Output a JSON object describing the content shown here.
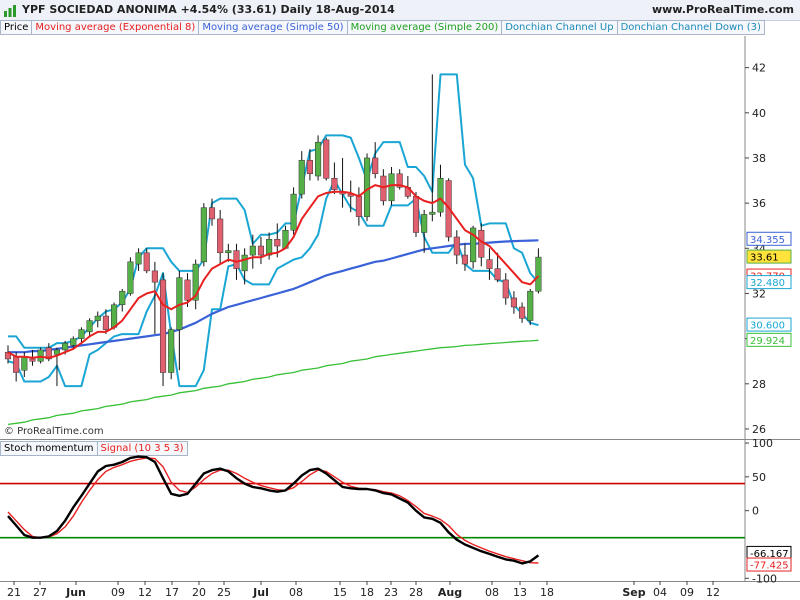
{
  "header": {
    "title": "YPF SOCIEDAD ANONIMA   +4.54% (33.61)   Daily   18-Aug-2014",
    "source": "www.ProRealTime.com"
  },
  "legend": [
    "Price",
    "Moving average (Exponential 8)",
    "Moving average (Simple 50)",
    "Moving average (Simple 200)",
    "Donchian Channel Up",
    "Donchian Channel Down (3)"
  ],
  "osc_legend": [
    "Stoch momentum",
    "Signal (10 3 5 3)"
  ],
  "copyright": "© ProRealTime.com",
  "colors": {
    "up": "#55b048",
    "down": "#e06070",
    "ema8": "#e82020",
    "sma50": "#3a62d8",
    "sma200": "#38c038",
    "donchian": "#1aa6d4",
    "stoch": "#000000",
    "signal": "#e82020",
    "level_upper": "#cc0000",
    "level_lower": "#008800"
  },
  "chart_data": [
    {
      "type": "candlestick",
      "title": "YPF SOCIEDAD ANONIMA",
      "ylim": [
        25.6,
        43.4
      ],
      "y_ticks": [
        26,
        28,
        30,
        32,
        34,
        36,
        38,
        40,
        42
      ],
      "x_ticks": [
        "21",
        "27",
        "Jun",
        "09",
        "12",
        "17",
        "20",
        "25",
        "Jul",
        "08",
        "15",
        "18",
        "23",
        "28",
        "Aug",
        "08",
        "13",
        "18",
        "Sep",
        "04",
        "09",
        "12"
      ],
      "value_labels": [
        {
          "text": "34.355",
          "value": 34.355,
          "series": "sma50"
        },
        {
          "text": "33.61",
          "value": 33.61,
          "series": "price"
        },
        {
          "text": "32.770",
          "value": 32.77,
          "series": "ema8"
        },
        {
          "text": "32.480",
          "value": 32.48,
          "series": "donchian"
        },
        {
          "text": "30.600",
          "value": 30.6,
          "series": "donchian"
        },
        {
          "text": "29.924",
          "value": 29.924,
          "series": "sma200"
        }
      ],
      "candles": [
        {
          "o": 29.4,
          "h": 29.7,
          "l": 28.9,
          "c": 29.1
        },
        {
          "o": 29.2,
          "h": 29.4,
          "l": 28.1,
          "c": 28.5
        },
        {
          "o": 28.6,
          "h": 29.4,
          "l": 28.3,
          "c": 29.2
        },
        {
          "o": 29.1,
          "h": 29.5,
          "l": 28.8,
          "c": 29.0
        },
        {
          "o": 29.0,
          "h": 29.6,
          "l": 28.9,
          "c": 29.5
        },
        {
          "o": 29.6,
          "h": 29.8,
          "l": 29.0,
          "c": 29.1
        },
        {
          "o": 29.3,
          "h": 29.6,
          "l": 27.9,
          "c": 29.5
        },
        {
          "o": 29.5,
          "h": 29.9,
          "l": 29.3,
          "c": 29.8
        },
        {
          "o": 29.7,
          "h": 30.1,
          "l": 29.5,
          "c": 30.0
        },
        {
          "o": 30.0,
          "h": 30.5,
          "l": 29.8,
          "c": 30.4
        },
        {
          "o": 30.3,
          "h": 30.9,
          "l": 30.1,
          "c": 30.8
        },
        {
          "o": 30.8,
          "h": 31.2,
          "l": 30.5,
          "c": 31.0
        },
        {
          "o": 31.0,
          "h": 31.3,
          "l": 30.2,
          "c": 30.4
        },
        {
          "o": 30.5,
          "h": 31.6,
          "l": 30.4,
          "c": 31.5
        },
        {
          "o": 31.5,
          "h": 32.2,
          "l": 31.2,
          "c": 32.1
        },
        {
          "o": 32.0,
          "h": 33.6,
          "l": 31.9,
          "c": 33.4
        },
        {
          "o": 33.3,
          "h": 34.0,
          "l": 33.0,
          "c": 33.8
        },
        {
          "o": 33.8,
          "h": 34.0,
          "l": 32.9,
          "c": 33.0
        },
        {
          "o": 33.0,
          "h": 33.4,
          "l": 30.2,
          "c": 32.5
        },
        {
          "o": 32.6,
          "h": 32.9,
          "l": 27.9,
          "c": 28.5
        },
        {
          "o": 28.5,
          "h": 30.5,
          "l": 28.2,
          "c": 30.4
        },
        {
          "o": 30.4,
          "h": 33.0,
          "l": 28.6,
          "c": 32.7
        },
        {
          "o": 32.6,
          "h": 32.9,
          "l": 31.4,
          "c": 31.7
        },
        {
          "o": 31.7,
          "h": 33.5,
          "l": 31.3,
          "c": 33.3
        },
        {
          "o": 33.4,
          "h": 36.0,
          "l": 33.2,
          "c": 35.8
        },
        {
          "o": 35.8,
          "h": 36.2,
          "l": 35.0,
          "c": 35.3
        },
        {
          "o": 35.3,
          "h": 35.7,
          "l": 33.3,
          "c": 33.8
        },
        {
          "o": 33.8,
          "h": 34.2,
          "l": 33.4,
          "c": 33.9
        },
        {
          "o": 33.9,
          "h": 34.2,
          "l": 32.6,
          "c": 33.1
        },
        {
          "o": 33.0,
          "h": 34.0,
          "l": 32.4,
          "c": 33.7
        },
        {
          "o": 33.7,
          "h": 34.6,
          "l": 33.1,
          "c": 34.1
        },
        {
          "o": 34.1,
          "h": 34.5,
          "l": 33.3,
          "c": 33.7
        },
        {
          "o": 33.7,
          "h": 34.7,
          "l": 33.5,
          "c": 34.4
        },
        {
          "o": 34.4,
          "h": 35.1,
          "l": 33.6,
          "c": 34.1
        },
        {
          "o": 34.0,
          "h": 35.0,
          "l": 34.0,
          "c": 34.8
        },
        {
          "o": 34.8,
          "h": 36.7,
          "l": 34.6,
          "c": 36.4
        },
        {
          "o": 36.4,
          "h": 38.3,
          "l": 36.2,
          "c": 37.9
        },
        {
          "o": 37.9,
          "h": 38.4,
          "l": 37.0,
          "c": 37.3
        },
        {
          "o": 37.2,
          "h": 39.0,
          "l": 37.0,
          "c": 38.7
        },
        {
          "o": 38.8,
          "h": 38.9,
          "l": 37.0,
          "c": 37.1
        },
        {
          "o": 37.1,
          "h": 37.8,
          "l": 36.4,
          "c": 36.6
        },
        {
          "o": 36.5,
          "h": 38.0,
          "l": 35.8,
          "c": 36.4
        },
        {
          "o": 36.4,
          "h": 37.0,
          "l": 35.6,
          "c": 36.3
        },
        {
          "o": 36.3,
          "h": 36.7,
          "l": 35.0,
          "c": 35.4
        },
        {
          "o": 35.4,
          "h": 38.2,
          "l": 35.2,
          "c": 38.0
        },
        {
          "o": 38.0,
          "h": 38.7,
          "l": 37.1,
          "c": 37.3
        },
        {
          "o": 37.2,
          "h": 37.5,
          "l": 35.9,
          "c": 36.1
        },
        {
          "o": 36.1,
          "h": 37.6,
          "l": 35.9,
          "c": 37.3
        },
        {
          "o": 37.3,
          "h": 37.5,
          "l": 36.6,
          "c": 36.7
        },
        {
          "o": 36.7,
          "h": 37.2,
          "l": 36.2,
          "c": 36.3
        },
        {
          "o": 36.3,
          "h": 36.5,
          "l": 34.5,
          "c": 34.7
        },
        {
          "o": 34.7,
          "h": 35.7,
          "l": 33.8,
          "c": 35.5
        },
        {
          "o": 35.5,
          "h": 41.7,
          "l": 35.2,
          "c": 35.6
        },
        {
          "o": 35.6,
          "h": 37.7,
          "l": 35.4,
          "c": 37.1
        },
        {
          "o": 37.0,
          "h": 37.1,
          "l": 34.3,
          "c": 34.5
        },
        {
          "o": 34.5,
          "h": 34.8,
          "l": 33.3,
          "c": 33.7
        },
        {
          "o": 33.7,
          "h": 34.2,
          "l": 33.0,
          "c": 33.3
        },
        {
          "o": 33.4,
          "h": 35.0,
          "l": 33.1,
          "c": 34.9
        },
        {
          "o": 34.8,
          "h": 35.1,
          "l": 33.2,
          "c": 33.6
        },
        {
          "o": 33.5,
          "h": 34.0,
          "l": 32.6,
          "c": 33.1
        },
        {
          "o": 33.1,
          "h": 33.8,
          "l": 32.5,
          "c": 32.6
        },
        {
          "o": 32.6,
          "h": 32.9,
          "l": 31.5,
          "c": 31.8
        },
        {
          "o": 31.8,
          "h": 32.1,
          "l": 31.1,
          "c": 31.4
        },
        {
          "o": 31.4,
          "h": 31.6,
          "l": 30.7,
          "c": 30.9
        },
        {
          "o": 30.8,
          "h": 32.2,
          "l": 30.6,
          "c": 32.1
        },
        {
          "o": 32.1,
          "h": 34.0,
          "l": 32.0,
          "c": 33.61
        }
      ],
      "ema8": [
        29.4,
        29.2,
        29.2,
        29.15,
        29.2,
        29.15,
        29.25,
        29.4,
        29.55,
        29.8,
        30.1,
        30.3,
        30.3,
        30.5,
        30.8,
        31.3,
        31.8,
        32.0,
        32.1,
        31.5,
        31.3,
        31.5,
        31.6,
        31.9,
        32.6,
        33.1,
        33.3,
        33.5,
        33.4,
        33.5,
        33.6,
        33.6,
        33.75,
        33.8,
        34.0,
        34.5,
        35.3,
        35.8,
        36.3,
        36.45,
        36.5,
        36.5,
        36.45,
        36.3,
        36.6,
        36.8,
        36.7,
        36.8,
        36.8,
        36.7,
        36.3,
        36.1,
        36.0,
        36.2,
        35.8,
        35.3,
        34.8,
        34.6,
        34.3,
        34.1,
        33.7,
        33.3,
        32.9,
        32.5,
        32.4,
        32.77
      ],
      "sma50": [
        29.4,
        29.4,
        29.4,
        29.45,
        29.45,
        29.5,
        29.55,
        29.6,
        29.65,
        29.7,
        29.75,
        29.8,
        29.85,
        29.9,
        29.95,
        30.0,
        30.05,
        30.1,
        30.15,
        30.2,
        30.3,
        30.4,
        30.55,
        30.7,
        30.9,
        31.1,
        31.25,
        31.4,
        31.5,
        31.6,
        31.7,
        31.8,
        31.9,
        32.0,
        32.1,
        32.2,
        32.35,
        32.5,
        32.65,
        32.8,
        32.9,
        33.0,
        33.1,
        33.2,
        33.3,
        33.4,
        33.45,
        33.55,
        33.65,
        33.75,
        33.85,
        33.95,
        34.0,
        34.05,
        34.1,
        34.15,
        34.2,
        34.2,
        34.22,
        34.25,
        34.28,
        34.3,
        34.32,
        34.33,
        34.34,
        34.355
      ],
      "sma200": [
        26.2,
        26.25,
        26.3,
        26.4,
        26.45,
        26.5,
        26.6,
        26.65,
        26.7,
        26.8,
        26.85,
        26.9,
        27.0,
        27.05,
        27.1,
        27.2,
        27.25,
        27.3,
        27.4,
        27.45,
        27.5,
        27.6,
        27.65,
        27.7,
        27.8,
        27.85,
        27.9,
        28.0,
        28.05,
        28.1,
        28.2,
        28.25,
        28.3,
        28.4,
        28.45,
        28.5,
        28.6,
        28.65,
        28.7,
        28.8,
        28.85,
        28.9,
        29.0,
        29.05,
        29.1,
        29.2,
        29.25,
        29.3,
        29.35,
        29.4,
        29.45,
        29.5,
        29.55,
        29.6,
        29.62,
        29.65,
        29.7,
        29.72,
        29.75,
        29.78,
        29.8,
        29.83,
        29.86,
        29.88,
        29.9,
        29.924
      ],
      "donchian_up": [
        30.1,
        30.1,
        29.6,
        29.6,
        29.6,
        29.6,
        29.8,
        29.8,
        29.9,
        30.1,
        30.5,
        30.9,
        31.2,
        31.3,
        31.6,
        32.2,
        33.6,
        34.0,
        34.0,
        34.0,
        33.4,
        33.0,
        33.0,
        33.0,
        33.5,
        36.0,
        36.2,
        36.2,
        36.2,
        35.7,
        34.2,
        34.6,
        34.6,
        34.7,
        35.1,
        35.1,
        36.7,
        38.3,
        38.4,
        39.0,
        39.0,
        39.0,
        38.9,
        38.0,
        37.0,
        38.2,
        38.7,
        38.7,
        38.7,
        37.6,
        37.6,
        37.2,
        36.5,
        41.7,
        41.7,
        41.7,
        37.7,
        37.1,
        35.0,
        35.1,
        35.1,
        35.1,
        34.0,
        33.8,
        32.9,
        32.48
      ],
      "donchian_down": [
        29.0,
        28.9,
        28.1,
        28.1,
        28.1,
        28.3,
        28.8,
        27.9,
        27.9,
        27.9,
        29.3,
        29.5,
        29.8,
        30.1,
        30.2,
        30.2,
        30.2,
        31.2,
        31.9,
        32.9,
        30.2,
        27.9,
        27.9,
        27.9,
        28.6,
        31.3,
        31.3,
        33.2,
        33.3,
        32.6,
        32.4,
        32.4,
        32.4,
        33.1,
        33.3,
        33.5,
        33.6,
        34.0,
        34.6,
        36.2,
        37.0,
        36.4,
        35.8,
        35.6,
        35.0,
        35.0,
        35.0,
        35.9,
        35.9,
        35.9,
        36.2,
        34.5,
        33.8,
        33.8,
        33.8,
        34.3,
        33.3,
        33.0,
        33.0,
        33.0,
        32.6,
        32.5,
        31.5,
        31.1,
        30.7,
        30.6
      ]
    },
    {
      "type": "line",
      "title": "Stoch momentum",
      "ylim": [
        -104,
        103
      ],
      "y_ticks": [
        100,
        50,
        0,
        -100
      ],
      "levels": [
        40,
        -40
      ],
      "value_labels": [
        {
          "text": "-66.167",
          "value": -66.167,
          "series": "stoch"
        },
        {
          "text": "-77.425",
          "value": -77.425,
          "series": "signal"
        }
      ],
      "series": [
        {
          "name": "Stoch momentum",
          "values": [
            -8,
            -22,
            -36,
            -40,
            -40,
            -38,
            -30,
            -15,
            5,
            22,
            40,
            58,
            66,
            68,
            72,
            78,
            80,
            79,
            72,
            48,
            25,
            22,
            25,
            40,
            55,
            60,
            62,
            58,
            48,
            40,
            35,
            33,
            30,
            28,
            30,
            40,
            52,
            60,
            62,
            55,
            45,
            35,
            33,
            32,
            32,
            30,
            26,
            24,
            18,
            12,
            0,
            -10,
            -12,
            -18,
            -32,
            -43,
            -50,
            -55,
            -60,
            -64,
            -68,
            -72,
            -74,
            -78,
            -75,
            -66.167
          ]
        },
        {
          "name": "Signal (10 3 5 3)",
          "values": [
            -2,
            -15,
            -28,
            -38,
            -40,
            -39,
            -34,
            -24,
            -8,
            12,
            30,
            46,
            58,
            64,
            68,
            73,
            76,
            78,
            77,
            65,
            42,
            30,
            27,
            35,
            46,
            55,
            60,
            60,
            55,
            48,
            42,
            37,
            34,
            31,
            30,
            34,
            43,
            53,
            60,
            58,
            50,
            42,
            36,
            33,
            32,
            31,
            28,
            26,
            22,
            15,
            6,
            -4,
            -8,
            -13,
            -22,
            -35,
            -44,
            -50,
            -55,
            -60,
            -64,
            -68,
            -71,
            -74,
            -77,
            -77.425
          ]
        }
      ]
    }
  ]
}
